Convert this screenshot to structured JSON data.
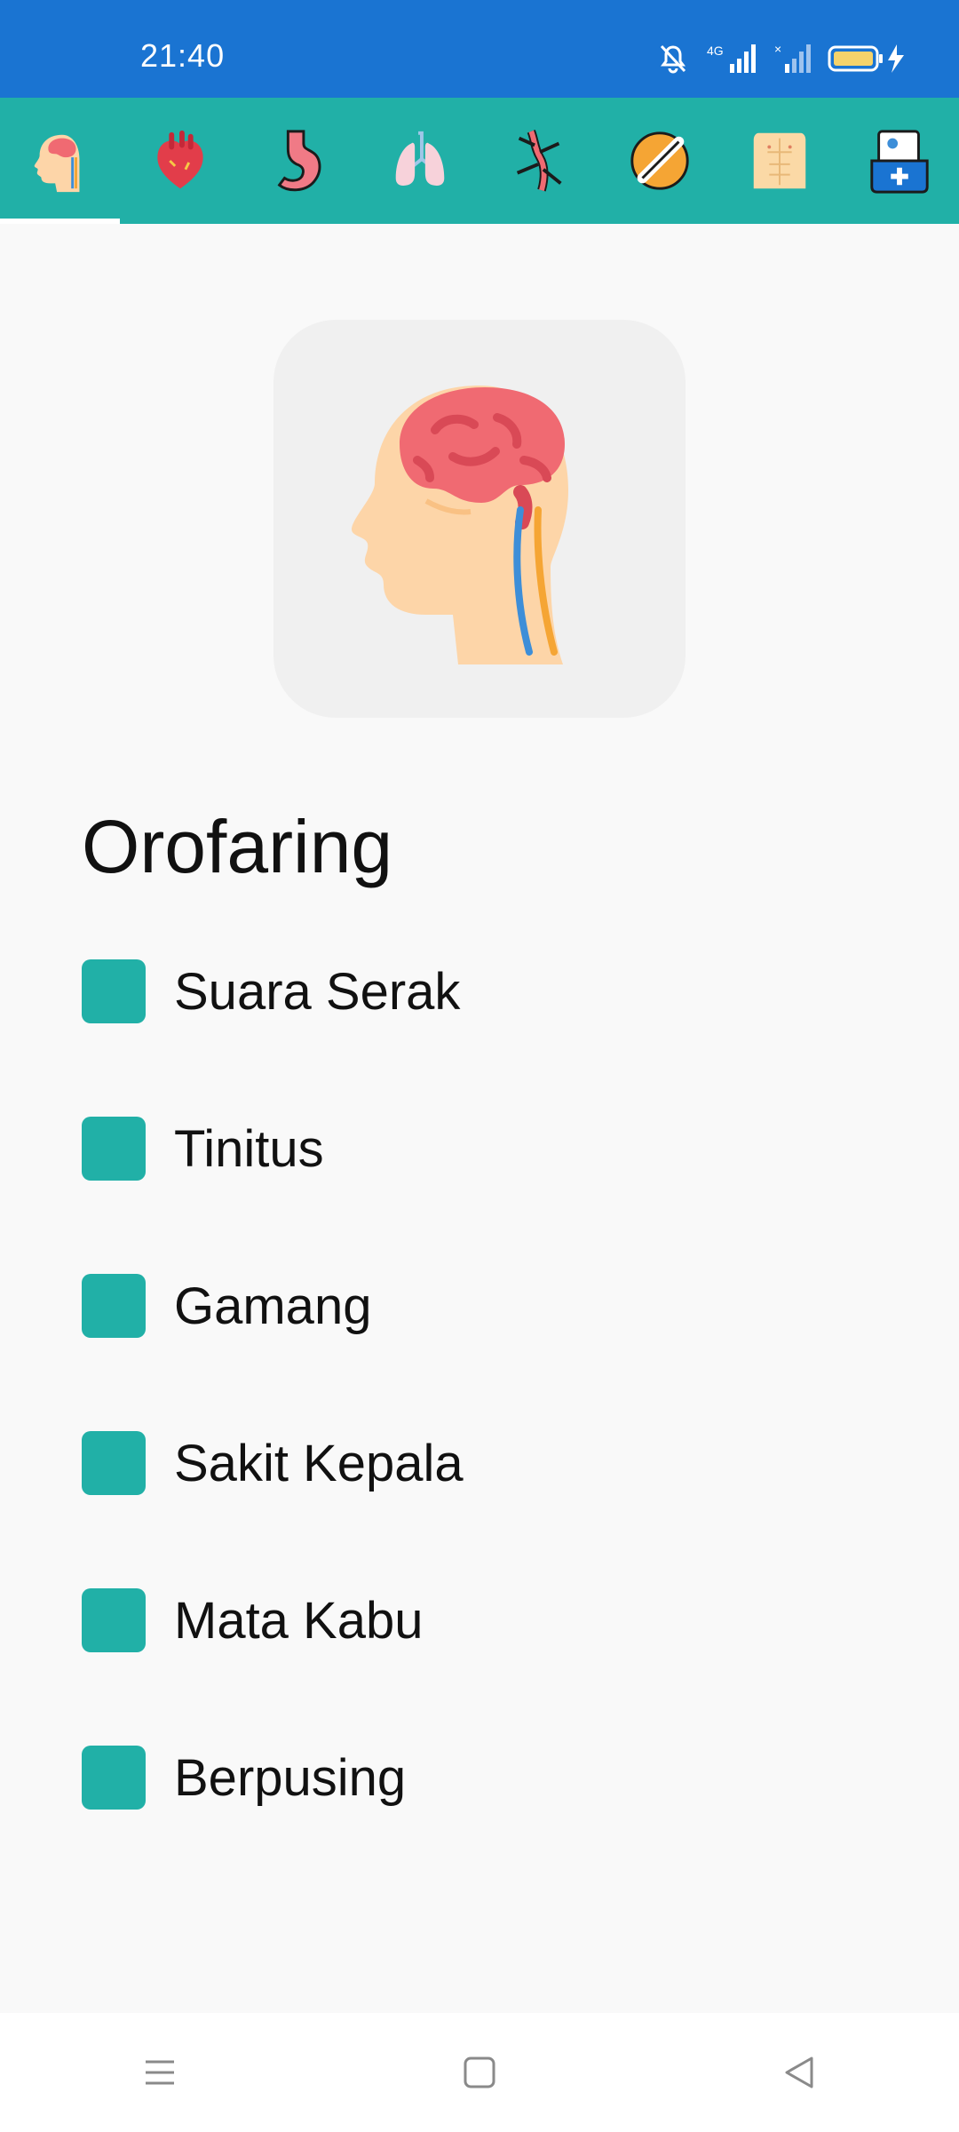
{
  "status_bar": {
    "time": "21:40",
    "network_label": "4G"
  },
  "tabs": [
    {
      "name": "head-brain-icon",
      "selected": true
    },
    {
      "name": "heart-icon",
      "selected": false
    },
    {
      "name": "stomach-icon",
      "selected": false
    },
    {
      "name": "lungs-icon",
      "selected": false
    },
    {
      "name": "blood-vessels-icon",
      "selected": false
    },
    {
      "name": "joint-icon",
      "selected": false
    },
    {
      "name": "torso-icon",
      "selected": false
    },
    {
      "name": "medical-record-icon",
      "selected": false
    }
  ],
  "hero": {
    "icon": "head-brain-icon"
  },
  "section": {
    "title": "Orofaring"
  },
  "symptoms": [
    {
      "label": "Suara Serak"
    },
    {
      "label": "Tinitus"
    },
    {
      "label": "Gamang"
    },
    {
      "label": "Sakit Kepala"
    },
    {
      "label": "Mata Kabu"
    },
    {
      "label": "Berpusing"
    }
  ],
  "colors": {
    "status_bar": "#1a74d2",
    "accent": "#21b0a7",
    "background": "#f9f9f9"
  }
}
